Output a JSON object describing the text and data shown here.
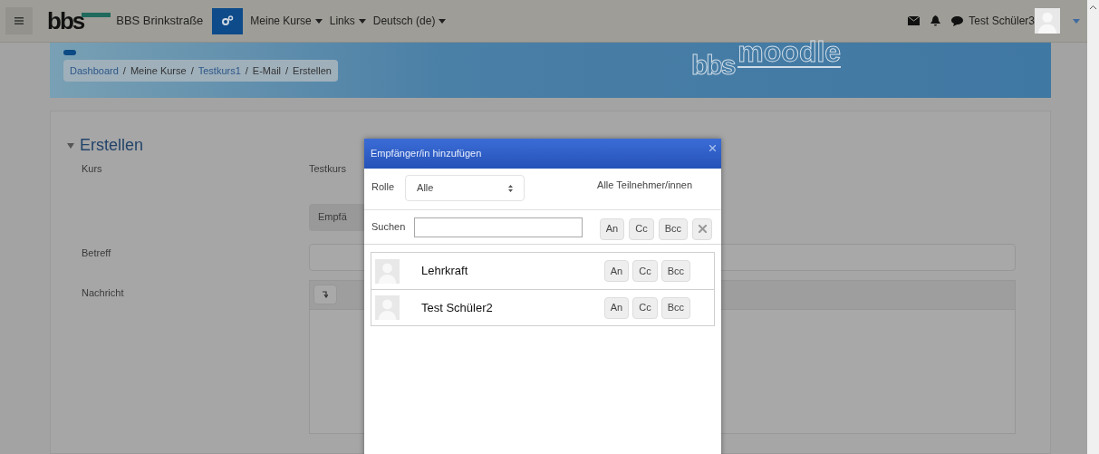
{
  "navbar": {
    "logo": "bbs",
    "site_name": "BBS Brinkstraße",
    "menus": [
      {
        "label": "Meine Kurse"
      },
      {
        "label": "Links"
      },
      {
        "label": "Deutsch (de)"
      }
    ],
    "user_name": "Test Schüler3"
  },
  "banner": {
    "separator": "/",
    "breadcrumbs": [
      {
        "label": "Dashboard",
        "link": true
      },
      {
        "label": "Meine Kurse",
        "link": false
      },
      {
        "label": "Testkurs1",
        "link": true
      },
      {
        "label": "E-Mail",
        "link": false
      },
      {
        "label": "Erstellen",
        "link": false
      }
    ],
    "logo_left": "bbs",
    "logo_right": "moodle"
  },
  "form": {
    "section_title": "Erstellen",
    "expanded": true,
    "course_label": "Kurs",
    "course_value": "Testkurs",
    "recipients_button": "Empfä",
    "subject_label": "Betreff",
    "message_label": "Nachricht"
  },
  "dialog": {
    "title": "Empfänger/in hinzufügen",
    "role_label": "Rolle",
    "role_value": "Alle",
    "all_participants": "Alle Teilnehmer/innen",
    "search_label": "Suchen",
    "buttons": [
      "An",
      "Cc",
      "Bcc"
    ],
    "users": [
      {
        "name": "Lehrkraft",
        "buttons": [
          "An",
          "Cc",
          "Bcc"
        ]
      },
      {
        "name": "Test Schüler2",
        "buttons": [
          "An",
          "Cc",
          "Bcc"
        ]
      }
    ]
  }
}
